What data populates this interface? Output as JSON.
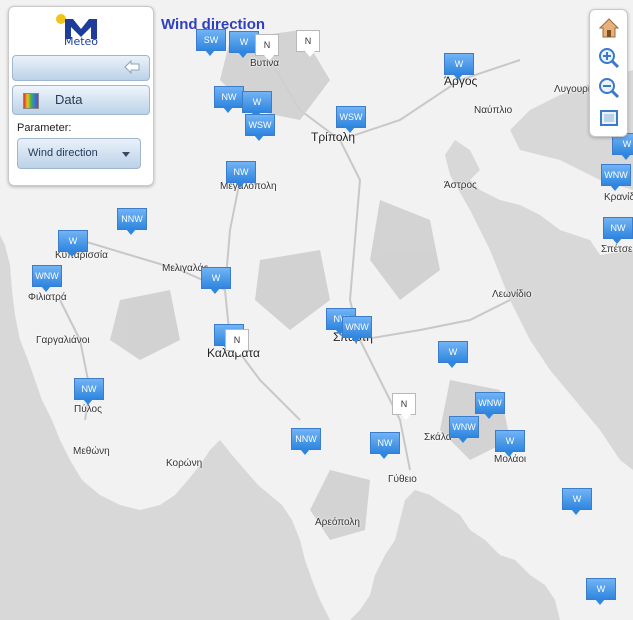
{
  "app": {
    "logo_text": "Meteo"
  },
  "title": "Wind direction",
  "panel": {
    "data_button": "Data",
    "parameter_label": "Parameter:",
    "parameter_value": "Wind direction"
  },
  "cities": [
    {
      "id": "vytina",
      "label": "Βυτίνα",
      "big": false
    },
    {
      "id": "argos",
      "label": "Άργος",
      "big": true
    },
    {
      "id": "nafplio",
      "label": "Ναύπλιο",
      "big": false
    },
    {
      "id": "lygourio",
      "label": "Λυγουριό",
      "big": false
    },
    {
      "id": "tripoli",
      "label": "Τρίπολη",
      "big": true
    },
    {
      "id": "astros",
      "label": "Άστρος",
      "big": false
    },
    {
      "id": "megalopoli",
      "label": "Μεγαλόπολη",
      "big": false
    },
    {
      "id": "kranidi",
      "label": "Κρανίδι",
      "big": false
    },
    {
      "id": "spetses",
      "label": "Σπέτσες",
      "big": false
    },
    {
      "id": "kyparissia",
      "label": "Κυπαρισσία",
      "big": false
    },
    {
      "id": "meligalas",
      "label": "Μελιγαλάς",
      "big": false
    },
    {
      "id": "filiatra",
      "label": "Φιλιατρά",
      "big": false
    },
    {
      "id": "leonidio",
      "label": "Λεωνίδιο",
      "big": false
    },
    {
      "id": "gargalianoi",
      "label": "Γαργαλιάνοι",
      "big": false
    },
    {
      "id": "kalamata",
      "label": "Καλαμάτα",
      "big": true
    },
    {
      "id": "sparti",
      "label": "Σπάρτη",
      "big": true
    },
    {
      "id": "pylos",
      "label": "Πύλος",
      "big": false
    },
    {
      "id": "skala",
      "label": "Σκάλα",
      "big": false
    },
    {
      "id": "methoni",
      "label": "Μεθώνη",
      "big": false
    },
    {
      "id": "koroni",
      "label": "Κορώνη",
      "big": false
    },
    {
      "id": "molaoi",
      "label": "Μολάοι",
      "big": false
    },
    {
      "id": "gytheio",
      "label": "Γύθειο",
      "big": false
    },
    {
      "id": "areopoli",
      "label": "Αρεόπολη",
      "big": false
    }
  ],
  "markers": [
    {
      "dir": "SW"
    },
    {
      "dir": "W"
    },
    {
      "dir": "N"
    },
    {
      "dir": "N"
    },
    {
      "dir": "W"
    },
    {
      "dir": "NW"
    },
    {
      "dir": "W"
    },
    {
      "dir": "WSW"
    },
    {
      "dir": "WSW"
    },
    {
      "dir": "NW"
    },
    {
      "dir": "W"
    },
    {
      "dir": "NNW"
    },
    {
      "dir": "W"
    },
    {
      "dir": "WNW"
    },
    {
      "dir": "W"
    },
    {
      "dir": "WNW"
    },
    {
      "dir": "NW"
    },
    {
      "dir": "NW"
    },
    {
      "dir": "W"
    },
    {
      "dir": "NW"
    },
    {
      "dir": "N"
    },
    {
      "dir": "WNW"
    },
    {
      "dir": "WNW"
    },
    {
      "dir": "W"
    },
    {
      "dir": "NNW"
    },
    {
      "dir": "NW"
    },
    {
      "dir": "W"
    },
    {
      "dir": "W"
    },
    {
      "dir": "W"
    },
    {
      "dir": "WNW"
    },
    {
      "dir": "NW"
    },
    {
      "dir": "W"
    }
  ],
  "colors": {
    "land": "#f2f2f2",
    "sea": "#d8d8d8",
    "marker": "#3a8be0",
    "title": "#2f3fbf"
  }
}
